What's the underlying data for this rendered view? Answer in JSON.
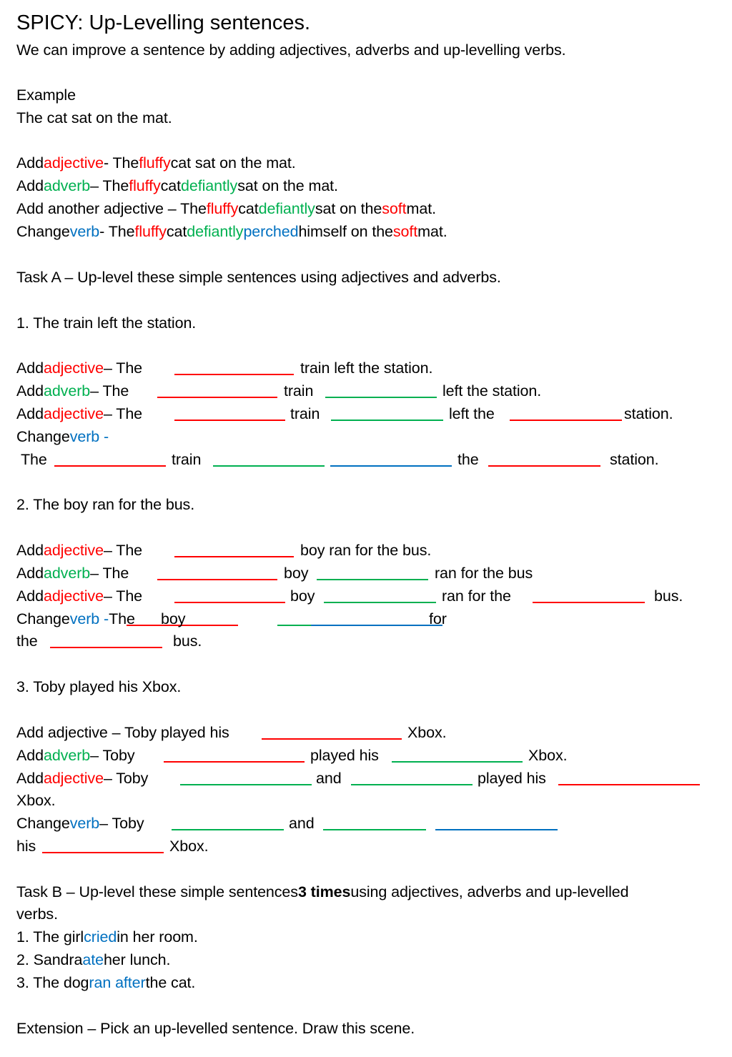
{
  "title": "SPICY: Up-Levelling sentences.",
  "colors": {
    "adjective": "#ff0000",
    "adverb": "#00b050",
    "verb": "#0070c0",
    "text": "#000000"
  },
  "lines": [
    {
      "id": "intro",
      "segs": [
        {
          "t": "We can improve a sentence by adding adjectives, adverbs and up-levelling verbs."
        }
      ]
    },
    {
      "id": "example-heading",
      "segs": [
        {
          "t": "Example"
        }
      ]
    },
    {
      "id": "example-sentence",
      "segs": [
        {
          "t": "The cat sat on the mat."
        }
      ]
    },
    {
      "id": "example-add-adjective",
      "segs": [
        {
          "t": "Add "
        },
        {
          "t": "adjective",
          "c": "red"
        },
        {
          "t": " - The "
        },
        {
          "t": "fluffy",
          "c": "red"
        },
        {
          "t": " cat sat on the mat."
        }
      ]
    },
    {
      "id": "example-add-adverb",
      "segs": [
        {
          "t": "Add "
        },
        {
          "t": "adverb",
          "c": "green"
        },
        {
          "t": " – The "
        },
        {
          "t": "fluffy",
          "c": "red"
        },
        {
          "t": " cat "
        },
        {
          "t": "defiantly",
          "c": "green"
        },
        {
          "t": " sat on the mat."
        }
      ]
    },
    {
      "id": "example-add-another-adjective",
      "segs": [
        {
          "t": "Add another adjective – The "
        },
        {
          "t": "fluffy",
          "c": "red"
        },
        {
          "t": " cat "
        },
        {
          "t": "defiantly",
          "c": "green"
        },
        {
          "t": " sat on the "
        },
        {
          "t": "soft",
          "c": "red"
        },
        {
          "t": " mat."
        }
      ]
    },
    {
      "id": "example-change-verb",
      "segs": [
        {
          "t": "Change "
        },
        {
          "t": "verb",
          "c": "blue"
        },
        {
          "t": " - The "
        },
        {
          "t": "fluffy",
          "c": "red"
        },
        {
          "t": " cat "
        },
        {
          "t": "defiantly",
          "c": "green"
        },
        {
          "t": " "
        },
        {
          "t": "perched",
          "c": "blue"
        },
        {
          "t": " himself on the "
        },
        {
          "t": "soft",
          "c": "red"
        },
        {
          "t": " mat."
        }
      ]
    },
    {
      "id": "task-a-heading",
      "segs": [
        {
          "t": "Task A – Up-level these simple sentences using adjectives and adverbs."
        }
      ]
    },
    {
      "id": "a1-sentence",
      "segs": [
        {
          "t": "1. The train left the station."
        }
      ]
    },
    {
      "id": "a1-adjective",
      "segs": [
        {
          "t": "Add "
        },
        {
          "t": "adjective",
          "c": "red"
        },
        {
          "t": " – The"
        },
        {
          "b": "red"
        },
        {
          "t": "train left the station."
        }
      ]
    },
    {
      "id": "a1-adverb",
      "segs": [
        {
          "t": "Add "
        },
        {
          "t": "adverb",
          "c": "green"
        },
        {
          "t": " – The"
        },
        {
          "b": "red"
        },
        {
          "t": "train"
        },
        {
          "b": "green"
        },
        {
          "t": "left the station."
        }
      ]
    },
    {
      "id": "a1-adjective-2",
      "segs": [
        {
          "t": "Add "
        },
        {
          "t": "adjective",
          "c": "red"
        },
        {
          "t": " – The"
        },
        {
          "b": "red"
        },
        {
          "t": "train"
        },
        {
          "b": "green"
        },
        {
          "t": "left the"
        },
        {
          "b": "red"
        },
        {
          "t": "station."
        }
      ]
    },
    {
      "id": "a1-change-verb",
      "segs": [
        {
          "t": "Change "
        },
        {
          "t": "verb -",
          "c": "blue"
        }
      ]
    },
    {
      "id": "a1-change-verb-cont",
      "segs": [
        {
          "t": "The"
        },
        {
          "b": "red"
        },
        {
          "t": "train"
        },
        {
          "b": "green"
        },
        {
          "b": "blue"
        },
        {
          "t": "the"
        },
        {
          "b": "red"
        },
        {
          "t": "station."
        }
      ]
    },
    {
      "id": "a2-sentence",
      "segs": [
        {
          "t": "2. The boy ran for the bus."
        }
      ]
    },
    {
      "id": "a2-adjective",
      "segs": [
        {
          "t": "Add "
        },
        {
          "t": "adjective",
          "c": "red"
        },
        {
          "t": " – The"
        },
        {
          "b": "red"
        },
        {
          "t": "boy ran for the bus."
        }
      ]
    },
    {
      "id": "a2-adverb",
      "segs": [
        {
          "t": "Add "
        },
        {
          "t": "adverb",
          "c": "green"
        },
        {
          "t": " – The"
        },
        {
          "b": "red"
        },
        {
          "t": "boy"
        },
        {
          "b": "green"
        },
        {
          "t": "ran for the bus"
        }
      ]
    },
    {
      "id": "a2-adjective-2",
      "segs": [
        {
          "t": "Add "
        },
        {
          "t": "adjective",
          "c": "red"
        },
        {
          "t": " – The"
        },
        {
          "b": "red"
        },
        {
          "t": "boy"
        },
        {
          "b": "green"
        },
        {
          "t": "ran for the"
        },
        {
          "b": "red"
        },
        {
          "t": "bus."
        }
      ]
    },
    {
      "id": "a2-change-verb",
      "segs": [
        {
          "t": "Change "
        },
        {
          "t": "verb - ",
          "c": "blue"
        },
        {
          "t": "The"
        },
        {
          "b": "red"
        },
        {
          "t": "boy"
        },
        {
          "b": "green"
        },
        {
          "b": "blue"
        },
        {
          "t": "for"
        }
      ]
    },
    {
      "id": "a2-change-verb-cont",
      "segs": [
        {
          "t": "the"
        },
        {
          "b": "red"
        },
        {
          "t": "bus."
        }
      ]
    },
    {
      "id": "a3-sentence",
      "segs": [
        {
          "t": "3. Toby played his Xbox."
        }
      ]
    },
    {
      "id": "a3-adjective",
      "segs": [
        {
          "t": "Add adjective – Toby played his"
        },
        {
          "b": "red"
        },
        {
          "t": "Xbox."
        }
      ]
    },
    {
      "id": "a3-adverb",
      "segs": [
        {
          "t": "Add "
        },
        {
          "t": "adverb",
          "c": "green"
        },
        {
          "t": " – Toby"
        },
        {
          "b": "red"
        },
        {
          "t": "played his"
        },
        {
          "b": "green"
        },
        {
          "t": "Xbox."
        }
      ]
    },
    {
      "id": "a3-adjective-2",
      "segs": [
        {
          "t": "Add "
        },
        {
          "t": "adjective",
          "c": "red"
        },
        {
          "t": " – Toby"
        },
        {
          "b": "green"
        },
        {
          "t": "and"
        },
        {
          "b": "green"
        },
        {
          "t": "played his"
        },
        {
          "b": "red"
        }
      ]
    },
    {
      "id": "a3-adjective-2-cont",
      "segs": [
        {
          "t": "Xbox."
        }
      ]
    },
    {
      "id": "a3-change-verb",
      "segs": [
        {
          "t": "Change "
        },
        {
          "t": "verb",
          "c": "blue"
        },
        {
          "t": " – Toby"
        },
        {
          "b": "green"
        },
        {
          "t": "and"
        },
        {
          "b": "green"
        },
        {
          "b": "blue"
        }
      ]
    },
    {
      "id": "a3-change-verb-cont",
      "segs": [
        {
          "t": "his"
        },
        {
          "b": "red"
        },
        {
          "t": "Xbox."
        }
      ]
    },
    {
      "id": "task-b-heading",
      "segs": [
        {
          "t": "Task B – Up-level these simple sentences "
        },
        {
          "t": "3 times",
          "bold": true
        },
        {
          "t": " using adjectives, adverbs and up-levelled"
        }
      ]
    },
    {
      "id": "task-b-heading-cont",
      "segs": [
        {
          "t": "verbs."
        }
      ]
    },
    {
      "id": "b1",
      "segs": [
        {
          "t": "1. The girl "
        },
        {
          "t": "cried",
          "c": "blue"
        },
        {
          "t": " in her room."
        }
      ]
    },
    {
      "id": "b2",
      "segs": [
        {
          "t": "2. Sandra "
        },
        {
          "t": "ate",
          "c": "blue"
        },
        {
          "t": " her lunch."
        }
      ]
    },
    {
      "id": "b3",
      "segs": [
        {
          "t": "3. The dog "
        },
        {
          "t": "ran after",
          "c": "blue"
        },
        {
          "t": " the cat."
        }
      ]
    },
    {
      "id": "extension",
      "segs": [
        {
          "t": "Extension – Pick an up-levelled sentence. Draw this scene."
        }
      ]
    }
  ]
}
